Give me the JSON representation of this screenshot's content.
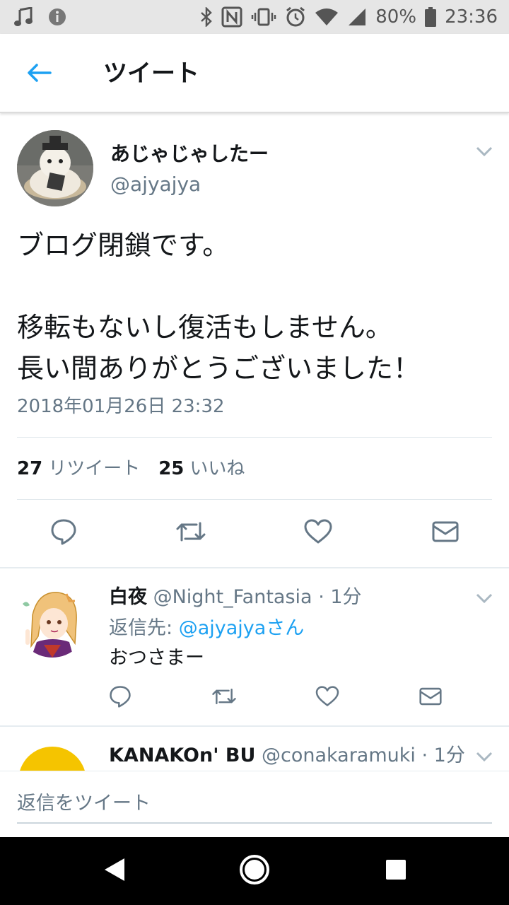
{
  "status_bar": {
    "battery": "80%",
    "time": "23:36",
    "icons": [
      "music-icon",
      "info-icon",
      "bluetooth-icon",
      "nfc-icon",
      "vibrate-icon",
      "alarm-icon",
      "wifi-icon",
      "signal-icon",
      "battery-icon"
    ]
  },
  "app_bar": {
    "title": "ツイート",
    "back_icon": "back-arrow-icon"
  },
  "main_tweet": {
    "name": "あじゃじゃしたー",
    "handle": "@ajyajya",
    "text_lines": [
      "ブログ閉鎖です。",
      "",
      "移転もないし復活もしません。",
      "長い間ありがとうございました！"
    ],
    "date": "2018年01月26日 23:32",
    "retweet_count": "27",
    "retweet_label": "リツイート",
    "like_count": "25",
    "like_label": "いいね",
    "actions": [
      "reply-icon",
      "retweet-icon",
      "like-icon",
      "message-icon"
    ]
  },
  "replies": [
    {
      "name": "白夜",
      "handle": "@Night_Fantasia",
      "time": "· 1分",
      "reply_to_label": "返信先:",
      "reply_to_mention": "@ajyajyaさん",
      "text": "おつさまー"
    },
    {
      "name": "KANAKOn' BU",
      "handle": "@conakaramuki",
      "time": "· 1分"
    }
  ],
  "compose": {
    "placeholder": "返信をツイート"
  },
  "colors": {
    "accent": "#1da1f2",
    "secondary_text": "#657786",
    "primary_text": "#14171a"
  }
}
